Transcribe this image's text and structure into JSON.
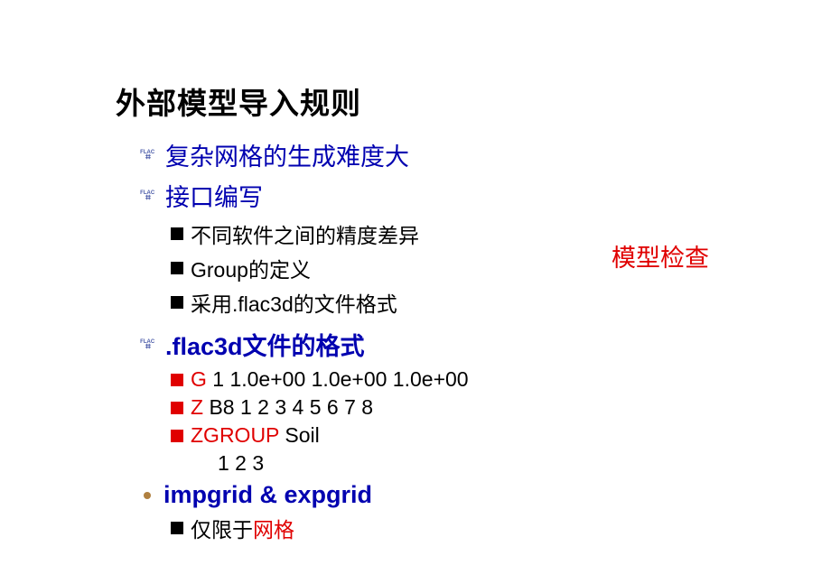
{
  "title": "外部模型导入规则",
  "sideNote": "模型检查",
  "bullets": {
    "item1": "复杂网格的生成难度大",
    "item2": "接口编写",
    "sub2a": "不同软件之间的精度差异",
    "sub2b_a": "Group",
    "sub2b_b": "的定义",
    "sub2c_a": "采用",
    "sub2c_b": ".flac3d",
    "sub2c_c": "的文件格式",
    "item3_a": ".flac3d",
    "item3_b": "文件的格式",
    "sub3a_cmd": "G",
    "sub3a_rest": " 1 1.0e+00 1.0e+00 1.0e+00",
    "sub3b_cmd": "Z",
    "sub3b_rest": " B8 1 2 3 4 5 6 7 8",
    "sub3c_cmd": "ZGROUP",
    "sub3c_rest": " Soil",
    "sub3c_line2": "1 2 3",
    "item4": "impgrid & expgrid",
    "sub4a_a": "仅限于",
    "sub4a_b": "网格"
  }
}
